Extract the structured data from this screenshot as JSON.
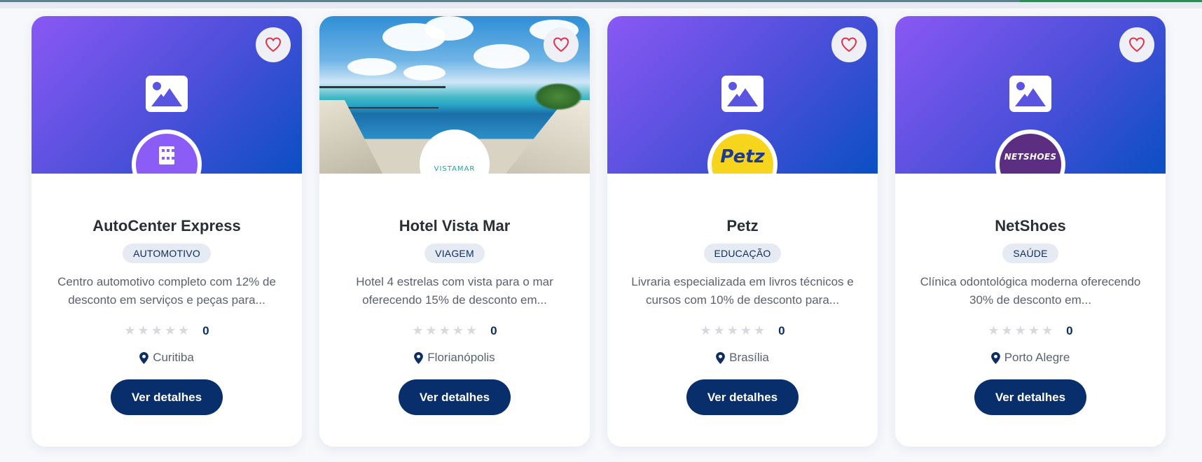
{
  "cards": [
    {
      "title": "AutoCenter Express",
      "category": "AUTOMOTIVO",
      "description": "Centro automotivo completo com 12% de desconto em serviços e peças para...",
      "rating_count": "0",
      "rating_stars": "★★★★★",
      "location": "Curitiba",
      "button_label": "Ver detalhes",
      "logo_icon": "building-icon"
    },
    {
      "title": "Hotel Vista Mar",
      "category": "VIAGEM",
      "description": "Hotel 4 estrelas com vista para o mar oferecendo 15% de desconto em...",
      "rating_count": "0",
      "rating_stars": "★★★★★",
      "location": "Florianópolis",
      "button_label": "Ver detalhes",
      "logo_text": "VISTAMAR"
    },
    {
      "title": "Petz",
      "category": "EDUCAÇÃO",
      "description": "Livraria especializada em livros técnicos e cursos com 10% de desconto para...",
      "rating_count": "0",
      "rating_stars": "★★★★★",
      "location": "Brasília",
      "button_label": "Ver detalhes",
      "logo_text": "Petz"
    },
    {
      "title": "NetShoes",
      "category": "SAÚDE",
      "description": "Clínica odontológica moderna oferecendo 30% de desconto em...",
      "rating_count": "0",
      "rating_stars": "★★★★★",
      "location": "Porto Alegre",
      "button_label": "Ver detalhes",
      "logo_text": "NETSHOES"
    }
  ],
  "colors": {
    "banner_gradient_start": "#8a58f4",
    "banner_gradient_end": "#0a4fc4",
    "button": "#082f6b",
    "heart": "#e0314b",
    "badge_bg": "#e6ebf3"
  },
  "icons": {
    "favorite": "heart-icon",
    "placeholder": "image-icon",
    "location": "map-pin-icon",
    "rating": "star-icon"
  }
}
